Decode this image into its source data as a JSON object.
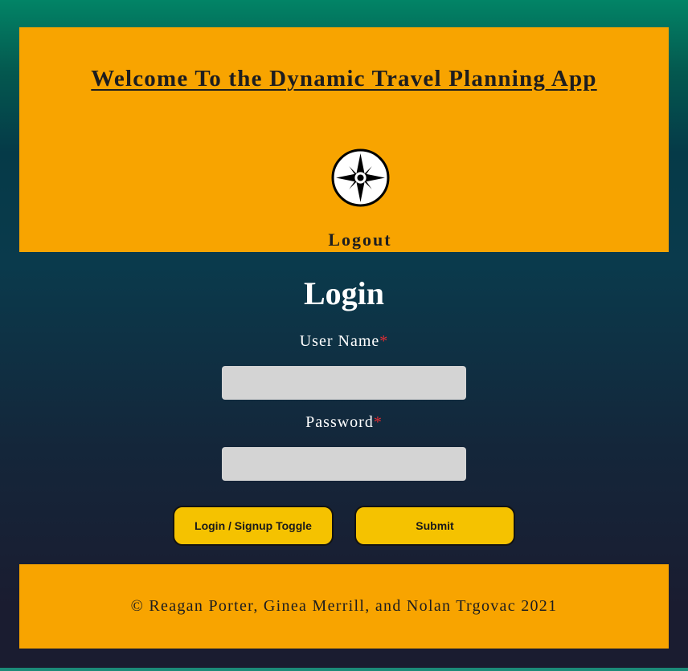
{
  "header": {
    "title": "Welcome To the Dynamic Travel Planning App",
    "logo_icon": "compass-rose-icon",
    "logout_label": "Logout"
  },
  "login_form": {
    "title": "Login",
    "username_label": "User Name",
    "password_label": "Password",
    "required_marker": "*",
    "username_value": "",
    "password_value": "",
    "toggle_button_label": "Login / Signup Toggle",
    "submit_button_label": "Submit"
  },
  "footer": {
    "copyright": "© Reagan Porter, Ginea Merrill, and Nolan Trgovac 2021"
  },
  "colors": {
    "header_bg": "#f8a400",
    "button_bg": "#f5c200",
    "input_bg": "#d4d4d4",
    "required": "#e12c33",
    "gradient_top": "#028466",
    "gradient_bottom": "#1a1c30"
  }
}
